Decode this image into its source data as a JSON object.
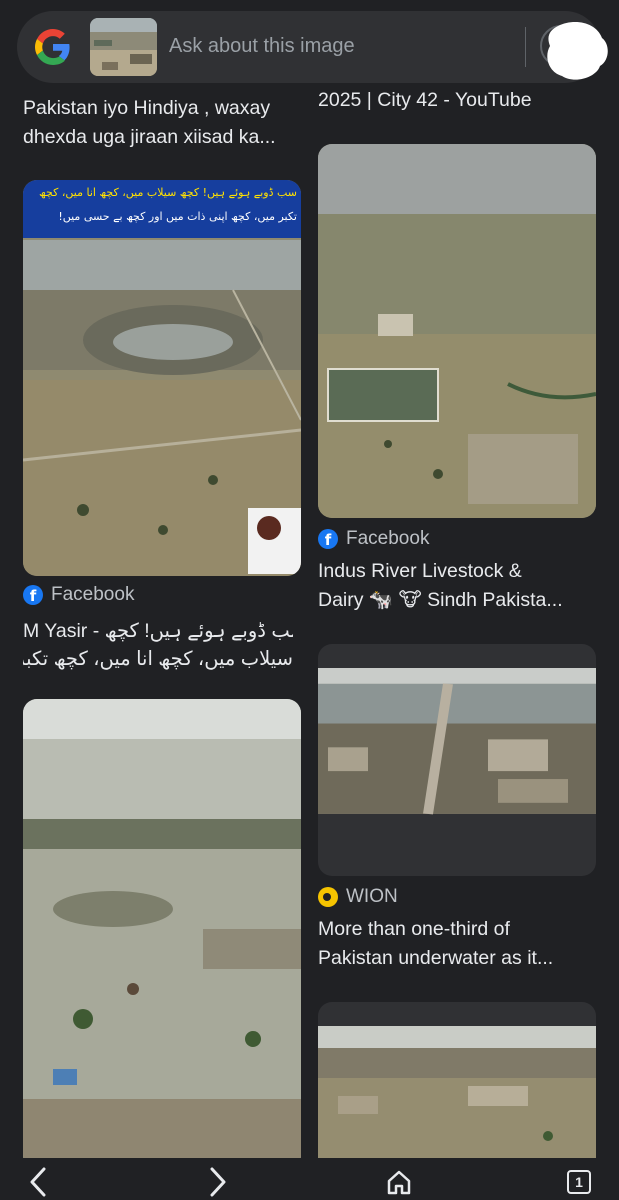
{
  "search": {
    "placeholder": "Ask about this image"
  },
  "results": {
    "top_left_title": "Pakistan iyo Hindiya , waxay dhexda uga jiraan xiisad ka...",
    "top_left_line1": "Pakistan iyo Hindiya , waxay",
    "top_left_line2": "dhexda uga jiraan xiisad ka...",
    "top_right_line1": "2025 | City 42 - YouTube",
    "card1": {
      "source": "Facebook",
      "title_line1": "M Yasir - سب ڈوبے ہوئے ہیں! کچھ",
      "title_line2": "سیلاب میں، کچھ انا میں، کچھ تکبر...",
      "banner_line1": "سب ڈوبے ہوئے ہیں! کچھ سیلاب میں، کچھ انا میں، کچھ",
      "banner_line2": "تکبر میں، کچھ اپنی ذات میں اور کچھ بے حسی میں!"
    },
    "card2": {
      "source": "Facebook",
      "title_line1": "Indus River Livestock &",
      "title_line2": "Dairy 🐄 🐮 Sindh Pakista..."
    },
    "card3": {
      "source": "WION",
      "title_line1": "More than one-third of",
      "title_line2": "Pakistan underwater as it..."
    }
  },
  "navbar": {
    "tab_count": "1"
  },
  "icons": {
    "back": "chevron-left-icon",
    "forward": "chevron-right-icon",
    "home": "home-icon",
    "tabs": "tab-switcher-icon",
    "facebook": "facebook-icon",
    "wion": "wion-icon",
    "google": "google-logo"
  },
  "colors": {
    "background": "#202124",
    "surface": "#303134",
    "facebook_blue": "#1877f2",
    "wion_yellow": "#f6c400"
  }
}
